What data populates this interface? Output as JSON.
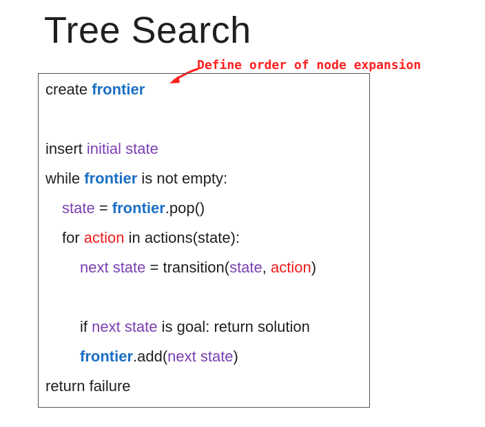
{
  "title": "Tree Search",
  "annotation": "Define order of node expansion",
  "colors": {
    "frontier": "#1a6fc4",
    "state_vars": "#7a3fb0",
    "action": "#ee1b1b",
    "annotation": "#ff1f1f"
  },
  "code": {
    "line1": {
      "a": "create ",
      "b": "frontier"
    },
    "line2": {
      "a": "insert ",
      "b": "initial state"
    },
    "line3": {
      "a": "while ",
      "b": "frontier",
      "c": " is not empty:"
    },
    "line4": {
      "a": "state",
      "b": " = ",
      "c": "frontier",
      "d": ".pop()"
    },
    "line5": {
      "a": "for ",
      "b": "action",
      "c": " in actions(state):"
    },
    "line6": {
      "a": "next state",
      "b": " = transition(",
      "c": "state",
      "d": ", ",
      "e": "action",
      "f": ")"
    },
    "line7": {
      "a": "if ",
      "b": "next state",
      "c": " is goal: return solution"
    },
    "line8": {
      "a": "frontier",
      "b": ".add(",
      "c": "next state",
      "d": ")"
    },
    "line9": {
      "a": "return failure"
    }
  }
}
